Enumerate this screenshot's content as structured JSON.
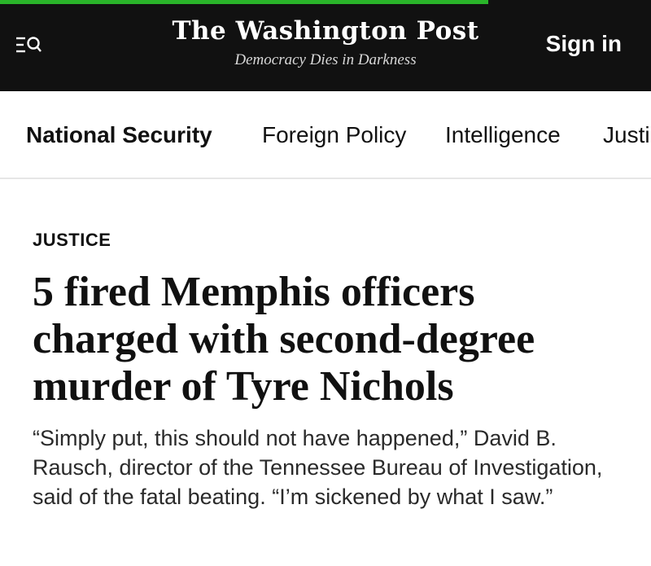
{
  "reading_progress": 0.75,
  "colors": {
    "header_bg": "#111111",
    "progress": "#2ab42a"
  },
  "header": {
    "menu_icon": "menu-search-icon",
    "logo_text": "The Washington Post",
    "tagline": "Democracy Dies in Darkness",
    "signin_label": "Sign in"
  },
  "subnav": {
    "items": [
      {
        "label": "National Security",
        "active": true
      },
      {
        "label": "Foreign Policy",
        "active": false
      },
      {
        "label": "Intelligence",
        "active": false
      },
      {
        "label": "Justi",
        "active": false
      }
    ]
  },
  "article": {
    "kicker": "JUSTICE",
    "headline": "5 fired Memphis officers charged with second-degree murder of Tyre Nichols",
    "dek": "“Simply put, this should not have happened,” David B. Rausch, director of the Tennessee Bureau of Investigation, said of the fatal beating. “I’m sickened by what I saw.”"
  }
}
